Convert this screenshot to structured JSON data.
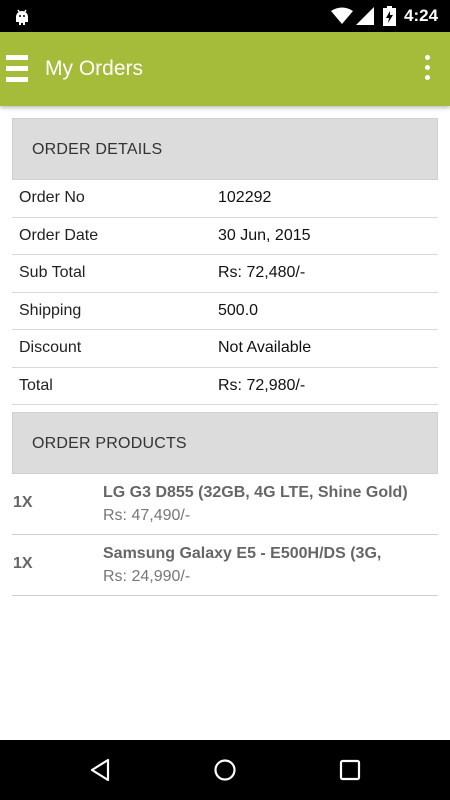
{
  "status_bar": {
    "time": "4:24",
    "icons": [
      "android-icon",
      "wifi-icon",
      "signal-icon",
      "battery-charging-icon"
    ]
  },
  "app_bar": {
    "title": "My Orders",
    "icons": [
      "menu-icon",
      "overflow-menu-icon"
    ]
  },
  "order_details": {
    "header": "ORDER DETAILS",
    "rows": [
      {
        "label": "Order No",
        "value": "102292"
      },
      {
        "label": "Order Date",
        "value": "30 Jun, 2015"
      },
      {
        "label": "Sub Total",
        "value": "Rs: 72,480/-"
      },
      {
        "label": "Shipping",
        "value": "500.0"
      },
      {
        "label": "Discount",
        "value": "Not Available"
      },
      {
        "label": "Total",
        "value": "Rs: 72,980/-"
      }
    ]
  },
  "order_products": {
    "header": "ORDER PRODUCTS",
    "items": [
      {
        "qty": "1X",
        "name": "LG G3 D855 (32GB, 4G LTE, Shine Gold)",
        "price": "Rs: 47,490/-"
      },
      {
        "qty": "1X",
        "name": "Samsung Galaxy E5 - E500H/DS (3G,",
        "price": "Rs: 24,990/-"
      }
    ]
  },
  "nav_bar": {
    "icons": [
      "back-icon",
      "home-icon",
      "recent-apps-icon"
    ]
  },
  "colors": {
    "app_bar": "#a5bb3a",
    "section_header_bg": "#dcdcdc",
    "status_bar": "#000000",
    "nav_bar": "#000000"
  }
}
